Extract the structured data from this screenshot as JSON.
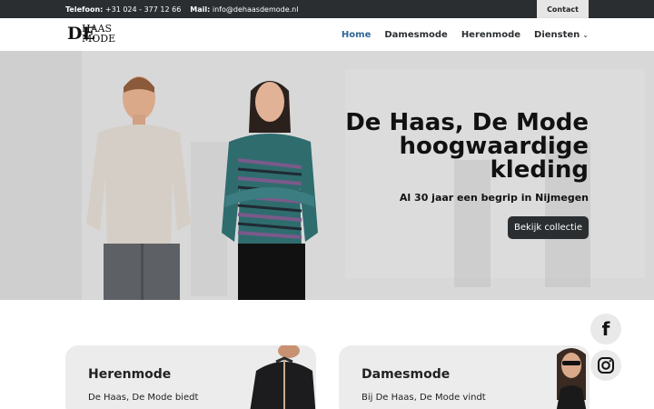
{
  "topbar": {
    "phone_label": "Telefoon:",
    "phone_value": "+31 024 - 377 12 66",
    "mail_label": "Mail:",
    "mail_value": "info@dehaasdemode.nl",
    "contact_label": "Contact"
  },
  "header": {
    "logo": {
      "line1": "HAAS",
      "line2": "MODE",
      "initials": "DE"
    },
    "nav": [
      {
        "label": "Home",
        "active": true
      },
      {
        "label": "Damesmode"
      },
      {
        "label": "Herenmode"
      },
      {
        "label": "Diensten",
        "has_dropdown": true
      }
    ]
  },
  "hero": {
    "title_lines": [
      "De Haas, De Mode",
      "hoogwaardige",
      "kleding"
    ],
    "subtitle": "Al 30 jaar een begrip in Nijmegen",
    "button_label": "Bekijk collectie",
    "button_color": "#2a2e31"
  },
  "cards": [
    {
      "title": "Herenmode",
      "text": "De Haas, De Mode biedt"
    },
    {
      "title": "Damesmode",
      "text": "Bij De Haas, De Mode vindt"
    }
  ],
  "social": [
    {
      "icon": "facebook-icon",
      "glyph": "f"
    },
    {
      "icon": "instagram-icon",
      "glyph": "instagram"
    }
  ],
  "colors": {
    "dark": "#2a2e31",
    "nav_active": "#2e6496",
    "card_bg": "#ececec"
  }
}
